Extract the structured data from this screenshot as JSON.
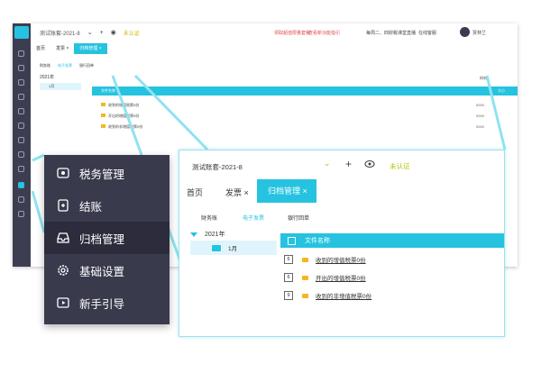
{
  "background_window": {
    "account_name": "测试账套-2021-8",
    "certification": "未认证",
    "promo_left": "领取超值限量套餐",
    "promo_right": "查看新功能指引",
    "live_text": "每周二、四财税课堂直播",
    "service": "在线客服",
    "user": "贾林兰",
    "tabs": [
      {
        "label": "首页"
      },
      {
        "label": "发票 ×"
      },
      {
        "label": "归档管理 ×"
      }
    ],
    "subtabs": {
      "a": "财务账",
      "b": "电子发票",
      "c": "银行回单"
    },
    "tree_year": "2021年",
    "tree_month": "1月",
    "list_header": "文件名称",
    "list_header_size": "大小",
    "refresh": "刷新",
    "rows": [
      {
        "name": "收到的增值税票0份",
        "size": "0000"
      },
      {
        "name": "开出的增值税票0份",
        "size": "0000"
      },
      {
        "name": "收到的非增值税票0份",
        "size": "0000"
      }
    ]
  },
  "menu": {
    "items": [
      {
        "label": "税务管理",
        "icon": "tax-management-icon"
      },
      {
        "label": "结账",
        "icon": "checkout-icon"
      },
      {
        "label": "归档管理",
        "icon": "archive-tray-icon",
        "active": true
      },
      {
        "label": "基础设置",
        "icon": "gear-icon"
      },
      {
        "label": "新手引导",
        "icon": "play-icon"
      }
    ]
  },
  "detail": {
    "account_name": "测试账套-2021-8",
    "certification": "未认证",
    "tabs": {
      "home": "首页",
      "invoice": "发票 ×",
      "archive": "归档管理 ×"
    },
    "subtabs": {
      "finance": "财务账",
      "einvoice": "电子发票",
      "bank": "银行回单"
    },
    "tree_year": "2021年",
    "tree_month": "1月",
    "list_header": "文件名称",
    "rows": [
      {
        "index": "6",
        "name": "收到的增值税票0份"
      },
      {
        "index": "6",
        "name": "开出的增值税票0份"
      },
      {
        "index": "9",
        "name": "收到的非增值税票0份"
      }
    ]
  },
  "colors": {
    "accent": "#25c3df",
    "sidebar": "#3a3a4d",
    "folder": "#f2b81e",
    "certification": "#b9c400"
  }
}
